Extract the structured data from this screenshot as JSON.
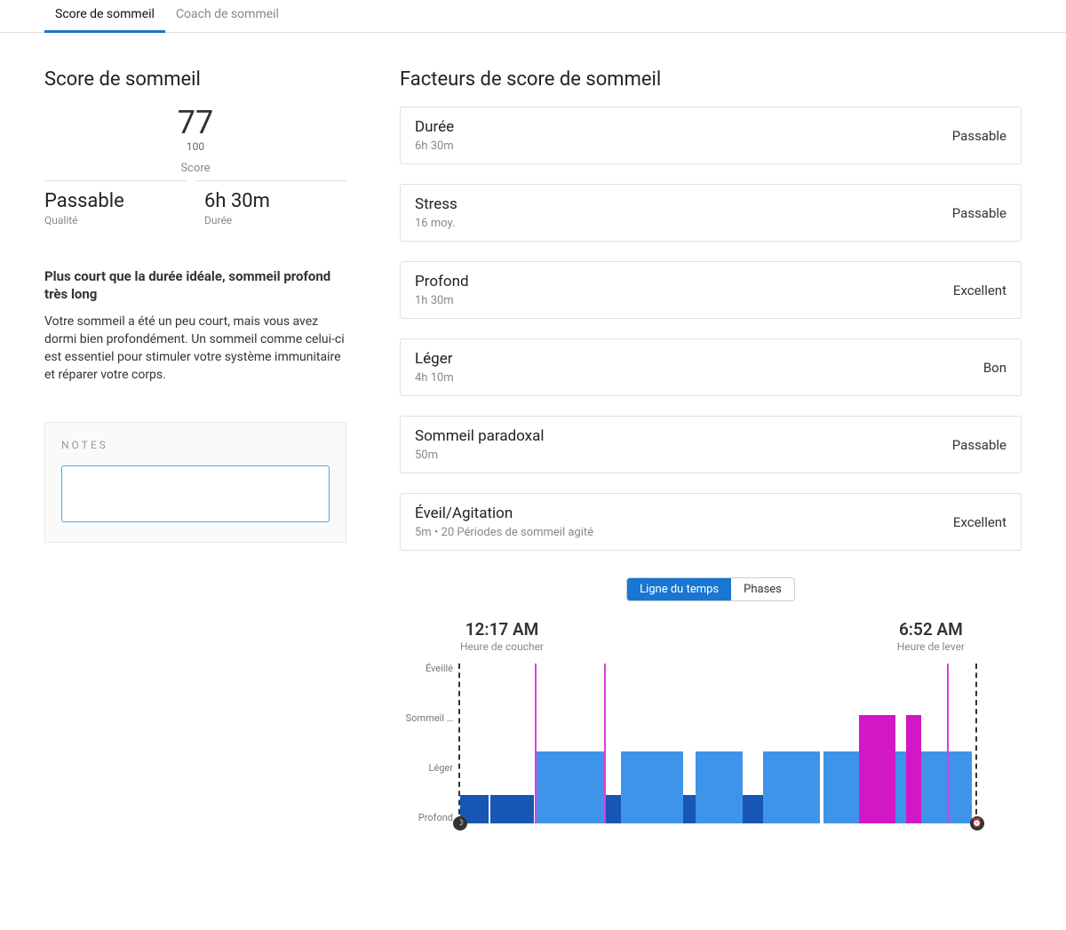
{
  "tabs": {
    "score": "Score de sommeil",
    "coach": "Coach de sommeil"
  },
  "left_title": "Score de sommeil",
  "score": {
    "value": "77",
    "max": "100",
    "label": "Score"
  },
  "quality": {
    "value": "Passable",
    "label": "Qualité"
  },
  "duration": {
    "value": "6h 30m",
    "label": "Durée"
  },
  "summary": {
    "head": "Plus court que la durée idéale, sommeil profond très long",
    "body": "Votre sommeil a été un peu court, mais vous avez dormi bien profondément. Un sommeil comme celui-ci est essentiel pour stimuler votre système immunitaire et réparer votre corps."
  },
  "notes_label": "NOTES",
  "factors_title": "Facteurs de score de sommeil",
  "factors": [
    {
      "title": "Durée",
      "sub": "6h 30m",
      "rating": "Passable"
    },
    {
      "title": "Stress",
      "sub": "16 moy.",
      "rating": "Passable"
    },
    {
      "title": "Profond",
      "sub": "1h 30m",
      "rating": "Excellent"
    },
    {
      "title": "Léger",
      "sub": "4h 10m",
      "rating": "Bon"
    },
    {
      "title": "Sommeil paradoxal",
      "sub": "50m",
      "rating": "Passable"
    },
    {
      "title": "Éveil/Agitation",
      "sub": "5m • 20 Périodes de sommeil agité",
      "rating": "Excellent"
    }
  ],
  "toggle": {
    "timeline": "Ligne du temps",
    "phases": "Phases"
  },
  "times": {
    "bed": {
      "value": "12:17 AM",
      "label": "Heure de coucher"
    },
    "wake": {
      "value": "6:52 AM",
      "label": "Heure de lever"
    }
  },
  "ylabels": {
    "awake": "Éveillé",
    "rem": "Sommeil …",
    "light": "Léger",
    "deep": "Profond"
  },
  "chart_data": {
    "type": "bar",
    "title": "",
    "xlabel": "",
    "ylabel": "",
    "y_levels": [
      "Éveillé",
      "Sommeil paradoxal",
      "Léger",
      "Profond"
    ],
    "x_range_minutes": 395,
    "bed_time": "12:17 AM",
    "wake_time": "6:52 AM",
    "segments": [
      {
        "stage": "deep",
        "start_pct": 0,
        "width_pct": 5.5
      },
      {
        "stage": "deep",
        "start_pct": 5.8,
        "width_pct": 8.5
      },
      {
        "stage": "wake",
        "start_pct": 14.5,
        "width_pct": 0.3
      },
      {
        "stage": "light",
        "start_pct": 14.8,
        "width_pct": 13
      },
      {
        "stage": "wake",
        "start_pct": 27.8,
        "width_pct": 0.3
      },
      {
        "stage": "deep",
        "start_pct": 28.1,
        "width_pct": 3
      },
      {
        "stage": "light",
        "start_pct": 31.1,
        "width_pct": 12
      },
      {
        "stage": "deep",
        "start_pct": 43.1,
        "width_pct": 2.5
      },
      {
        "stage": "light",
        "start_pct": 45.6,
        "width_pct": 9
      },
      {
        "stage": "deep",
        "start_pct": 54.6,
        "width_pct": 4
      },
      {
        "stage": "light",
        "start_pct": 58.6,
        "width_pct": 11
      },
      {
        "stage": "light",
        "start_pct": 70.2,
        "width_pct": 7
      },
      {
        "stage": "rem",
        "start_pct": 77.2,
        "width_pct": 7
      },
      {
        "stage": "light",
        "start_pct": 84.2,
        "width_pct": 2
      },
      {
        "stage": "rem",
        "start_pct": 86.2,
        "width_pct": 3
      },
      {
        "stage": "light",
        "start_pct": 89.2,
        "width_pct": 5
      },
      {
        "stage": "wake",
        "start_pct": 94.2,
        "width_pct": 0.3
      },
      {
        "stage": "light",
        "start_pct": 94.5,
        "width_pct": 4.5
      }
    ]
  }
}
